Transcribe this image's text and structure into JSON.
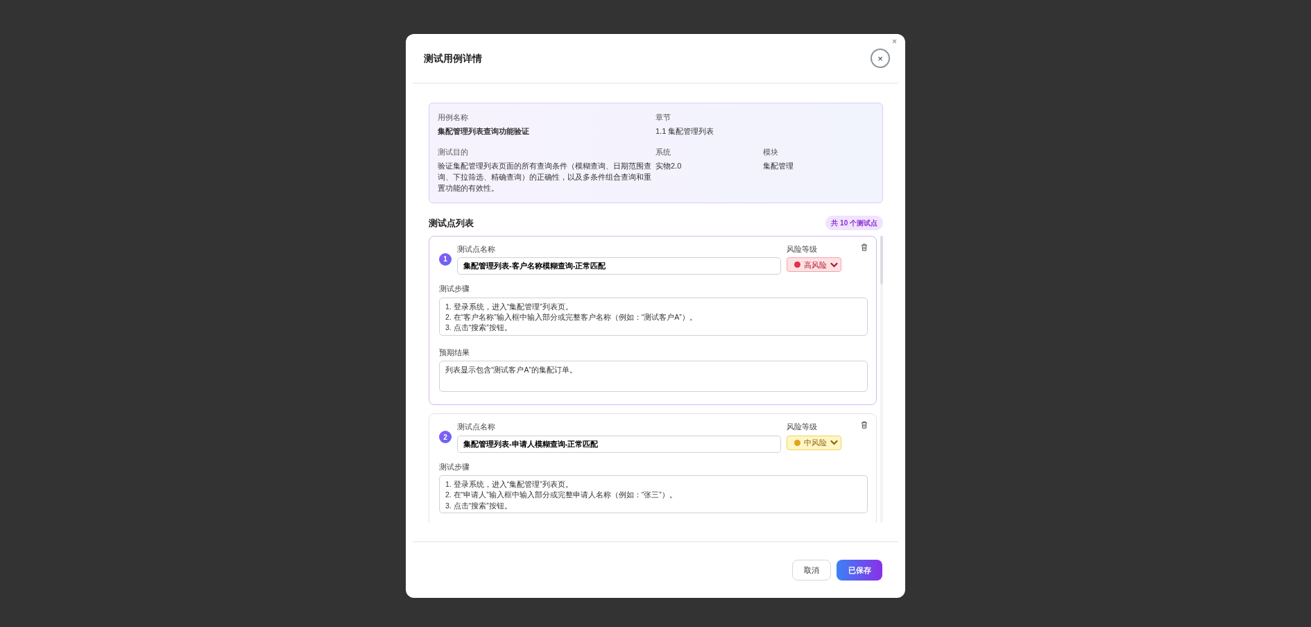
{
  "dialog": {
    "title": "测试用例详情",
    "corner_close": "×",
    "close": "×"
  },
  "info": [
    [
      {
        "label": "用例名称",
        "value": "集配管理列表查询功能验证",
        "emphasis": true
      },
      {
        "label": "章节",
        "value": "1.1 集配管理列表",
        "emphasis": false
      }
    ],
    [
      {
        "label": "测试目的",
        "value": "验证集配管理列表页面的所有查询条件（模糊查询、日期范围查询、下拉筛选、精确查询）的正确性，以及多条件组合查询和重置功能的有效性。",
        "emphasis": false
      },
      {
        "label": "系统",
        "value": "实物2.0",
        "emphasis": false
      },
      {
        "label": "模块",
        "value": "集配管理",
        "emphasis": false
      }
    ]
  ],
  "section": {
    "title": "测试点列表",
    "count": "共 10 个测试点"
  },
  "test_points": [
    {
      "number": "1",
      "selected": true,
      "name_label": "测试点名称",
      "name": "集配管理列表-客户名称模糊查询-正常匹配",
      "risk_label": "风险等级",
      "risk": {
        "kind": "high",
        "label": "高风险",
        "color": "#e0314b"
      },
      "steps_label": "测试步骤",
      "steps": "1. 登录系统，进入“集配管理”列表页。\n2. 在“客户名称”输入框中输入部分或完整客户名称（例如：“测试客户A”）。\n3. 点击“搜索”按钮。",
      "expected_label": "预期结果",
      "expected": "列表显示包含“测试客户A”的集配订单。"
    },
    {
      "number": "2",
      "selected": false,
      "name_label": "测试点名称",
      "name": "集配管理列表-申请人模糊查询-正常匹配",
      "risk_label": "风险等级",
      "risk": {
        "kind": "medium",
        "label": "中风险",
        "color": "#e0a41c"
      },
      "steps_label": "测试步骤",
      "steps": "1. 登录系统，进入“集配管理”列表页。\n2. 在“申请人”输入框中输入部分或完整申请人名称（例如：“张三”）。\n3. 点击“搜索”按钮。"
    }
  ],
  "footer": {
    "cancel": "取消",
    "save": "已保存"
  }
}
